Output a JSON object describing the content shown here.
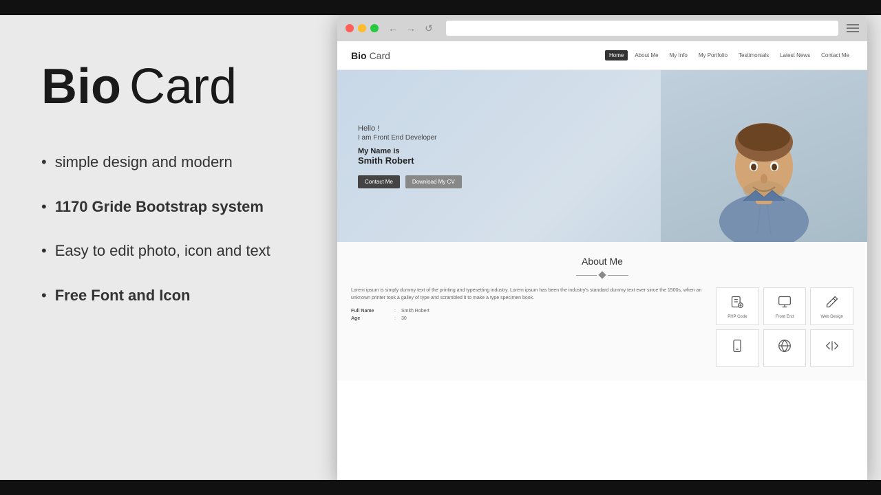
{
  "page": {
    "background_color": "#111",
    "left_bg": "#eaeaea",
    "right_bg": "#f0f0f0"
  },
  "title": {
    "bio": "Bio",
    "card": "Card"
  },
  "features": [
    {
      "text": "simple design and modern",
      "bold": false
    },
    {
      "text": "1170 Gride Bootstrap system",
      "bold": true,
      "bold_part": "1170 Gride Bootstrap system"
    },
    {
      "text": "Easy to edit photo, icon and text",
      "bold": false
    },
    {
      "text": "Free Font and Icon",
      "bold": true,
      "bold_part": "Free Font and Icon"
    }
  ],
  "browser": {
    "dots": [
      "red",
      "yellow",
      "green"
    ],
    "nav": [
      "←",
      "→",
      "↺"
    ]
  },
  "site": {
    "logo_bio": "Bio",
    "logo_card": "Card",
    "nav_items": [
      "Home",
      "About Me",
      "My Info",
      "My Portfolio",
      "Testimonials",
      "Latest News",
      "Contact Me"
    ],
    "active_nav": "Home"
  },
  "hero": {
    "greeting": "Hello !",
    "subtitle": "I am Front End Developer",
    "name_label": "My Name is",
    "name": "Smith Robert",
    "btn_contact": "Contact Me",
    "btn_download": "Download My CV"
  },
  "about": {
    "title": "About Me",
    "lorem_text": "Lorem ipsum is simply dummy text of the printing and typesetting industry. Lorem ipsum has been the industry's standard dummy text ever since the 1500s, when an unknown printer took a galley of type and scrambled it to make a type specimen book.",
    "fields": [
      {
        "name": "Full Name",
        "value": "Smith Robert"
      },
      {
        "name": "Age",
        "value": "30"
      }
    ],
    "skills": [
      {
        "icon": "📄",
        "label": "PHP Code"
      },
      {
        "icon": "🖥",
        "label": "Front End"
      },
      {
        "icon": "✏",
        "label": "Web Design"
      },
      {
        "icon": "📱",
        "label": ""
      },
      {
        "icon": "W",
        "label": ""
      },
      {
        "icon": "≡",
        "label": ""
      }
    ]
  }
}
